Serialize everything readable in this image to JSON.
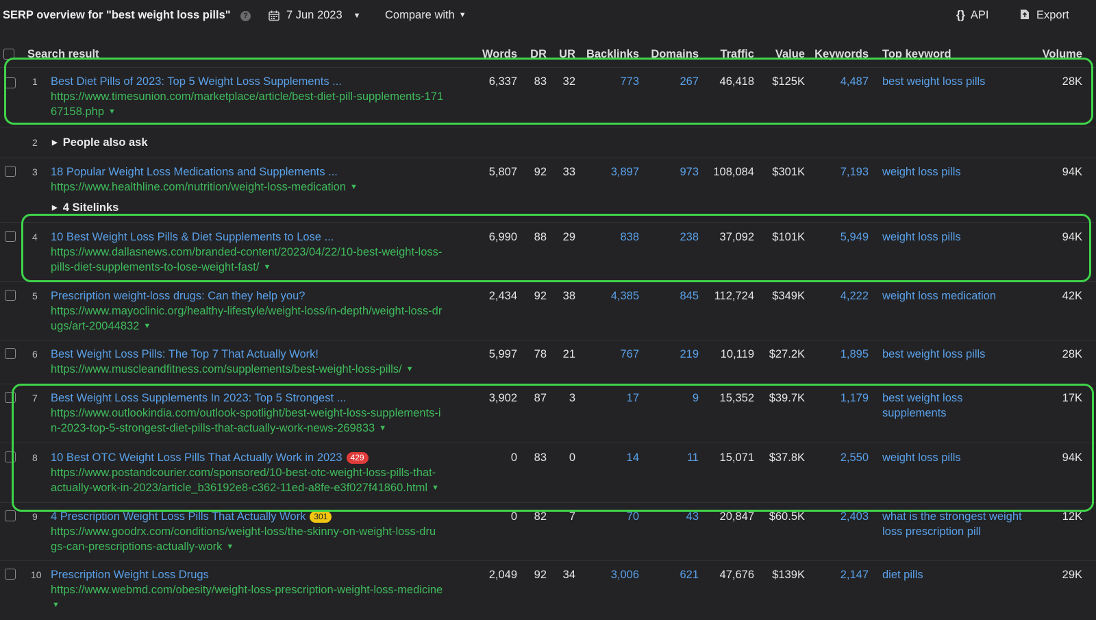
{
  "toolbar": {
    "title": "SERP overview for \"best weight loss pills\"",
    "help": "?",
    "date": "7 Jun 2023",
    "compare": "Compare with",
    "api": "API",
    "export": "Export"
  },
  "columns": [
    "Search result",
    "Words",
    "DR",
    "UR",
    "Backlinks",
    "Domains",
    "Traffic",
    "Value",
    "Keywords",
    "Top keyword",
    "Volume"
  ],
  "rows": [
    {
      "n": "1",
      "title": "Best Diet Pills of 2023: Top 5 Weight Loss Supplements ...",
      "url1": "https://www.timesunion.com/marketplace/article/best-diet-pill-supplements-171",
      "url2": "67158.php",
      "words": "6,337",
      "dr": "83",
      "ur": "32",
      "backlinks": "773",
      "domains": "267",
      "traffic": "46,418",
      "value": "$125K",
      "keywords": "4,487",
      "kw1": "best weight loss pills",
      "kw2": "",
      "volume": "28K"
    },
    {
      "n": "2",
      "paa": "People also ask"
    },
    {
      "n": "3",
      "title": "18 Popular Weight Loss Medications and Supplements ...",
      "url1": "https://www.healthline.com/nutrition/weight-loss-medication",
      "url2": "",
      "words": "5,807",
      "dr": "92",
      "ur": "33",
      "backlinks": "3,897",
      "domains": "973",
      "traffic": "108,084",
      "value": "$301K",
      "keywords": "7,193",
      "kw1": "weight loss pills",
      "kw2": "",
      "volume": "94K",
      "sitelinks": "4 Sitelinks"
    },
    {
      "n": "4",
      "title": "10 Best Weight Loss Pills & Diet Supplements to Lose ...",
      "url1": "https://www.dallasnews.com/branded-content/2023/04/22/10-best-weight-loss-",
      "url2": "pills-diet-supplements-to-lose-weight-fast/",
      "words": "6,990",
      "dr": "88",
      "ur": "29",
      "backlinks": "838",
      "domains": "238",
      "traffic": "37,092",
      "value": "$101K",
      "keywords": "5,949",
      "kw1": "weight loss pills",
      "kw2": "",
      "volume": "94K"
    },
    {
      "n": "5",
      "title": "Prescription weight-loss drugs: Can they help you?",
      "url1": "https://www.mayoclinic.org/healthy-lifestyle/weight-loss/in-depth/weight-loss-dr",
      "url2": "ugs/art-20044832",
      "words": "2,434",
      "dr": "92",
      "ur": "38",
      "backlinks": "4,385",
      "domains": "845",
      "traffic": "112,724",
      "value": "$349K",
      "keywords": "4,222",
      "kw1": "weight loss medication",
      "kw2": "",
      "volume": "42K"
    },
    {
      "n": "6",
      "title": "Best Weight Loss Pills: The Top 7 That Actually Work!",
      "url1": "https://www.muscleandfitness.com/supplements/best-weight-loss-pills/",
      "url2": "",
      "words": "5,997",
      "dr": "78",
      "ur": "21",
      "backlinks": "767",
      "domains": "219",
      "traffic": "10,119",
      "value": "$27.2K",
      "keywords": "1,895",
      "kw1": "best weight loss pills",
      "kw2": "",
      "volume": "28K"
    },
    {
      "n": "7",
      "title": "Best Weight Loss Supplements In 2023: Top 5 Strongest ...",
      "url1": "https://www.outlookindia.com/outlook-spotlight/best-weight-loss-supplements-i",
      "url2": "n-2023-top-5-strongest-diet-pills-that-actually-work-news-269833",
      "words": "3,902",
      "dr": "87",
      "ur": "3",
      "backlinks": "17",
      "domains": "9",
      "traffic": "15,352",
      "value": "$39.7K",
      "keywords": "1,179",
      "kw1": "best weight loss",
      "kw2": "supplements",
      "volume": "17K"
    },
    {
      "n": "8",
      "title": "10 Best OTC Weight Loss Pills That Actually Work in 2023",
      "badge": "429",
      "badgeColor": "red",
      "url1": "https://www.postandcourier.com/sponsored/10-best-otc-weight-loss-pills-that-",
      "url2": "actually-work-in-2023/article_b36192e8-c362-11ed-a8fe-e3f027f41860.html",
      "words": "0",
      "dr": "83",
      "ur": "0",
      "backlinks": "14",
      "domains": "11",
      "traffic": "15,071",
      "value": "$37.8K",
      "keywords": "2,550",
      "kw1": "weight loss pills",
      "kw2": "",
      "volume": "94K"
    },
    {
      "n": "9",
      "title": "4 Prescription Weight Loss Pills That Actually Work",
      "badge": "301",
      "badgeColor": "yellow",
      "url1": "https://www.goodrx.com/conditions/weight-loss/the-skinny-on-weight-loss-dru",
      "url2": "gs-can-prescriptions-actually-work",
      "words": "0",
      "dr": "82",
      "ur": "7",
      "backlinks": "70",
      "domains": "43",
      "traffic": "20,847",
      "value": "$60.5K",
      "keywords": "2,403",
      "kw1": "what is the strongest weight",
      "kw2": "loss prescription pill",
      "volume": "12K"
    },
    {
      "n": "10",
      "title": "Prescription Weight Loss Drugs",
      "url1": "https://www.webmd.com/obesity/weight-loss-prescription-weight-loss-medicine",
      "url2": "",
      "words": "2,049",
      "dr": "92",
      "ur": "34",
      "backlinks": "3,006",
      "domains": "621",
      "traffic": "47,676",
      "value": "$139K",
      "keywords": "2,147",
      "kw1": "diet pills",
      "kw2": "",
      "volume": "29K"
    }
  ]
}
